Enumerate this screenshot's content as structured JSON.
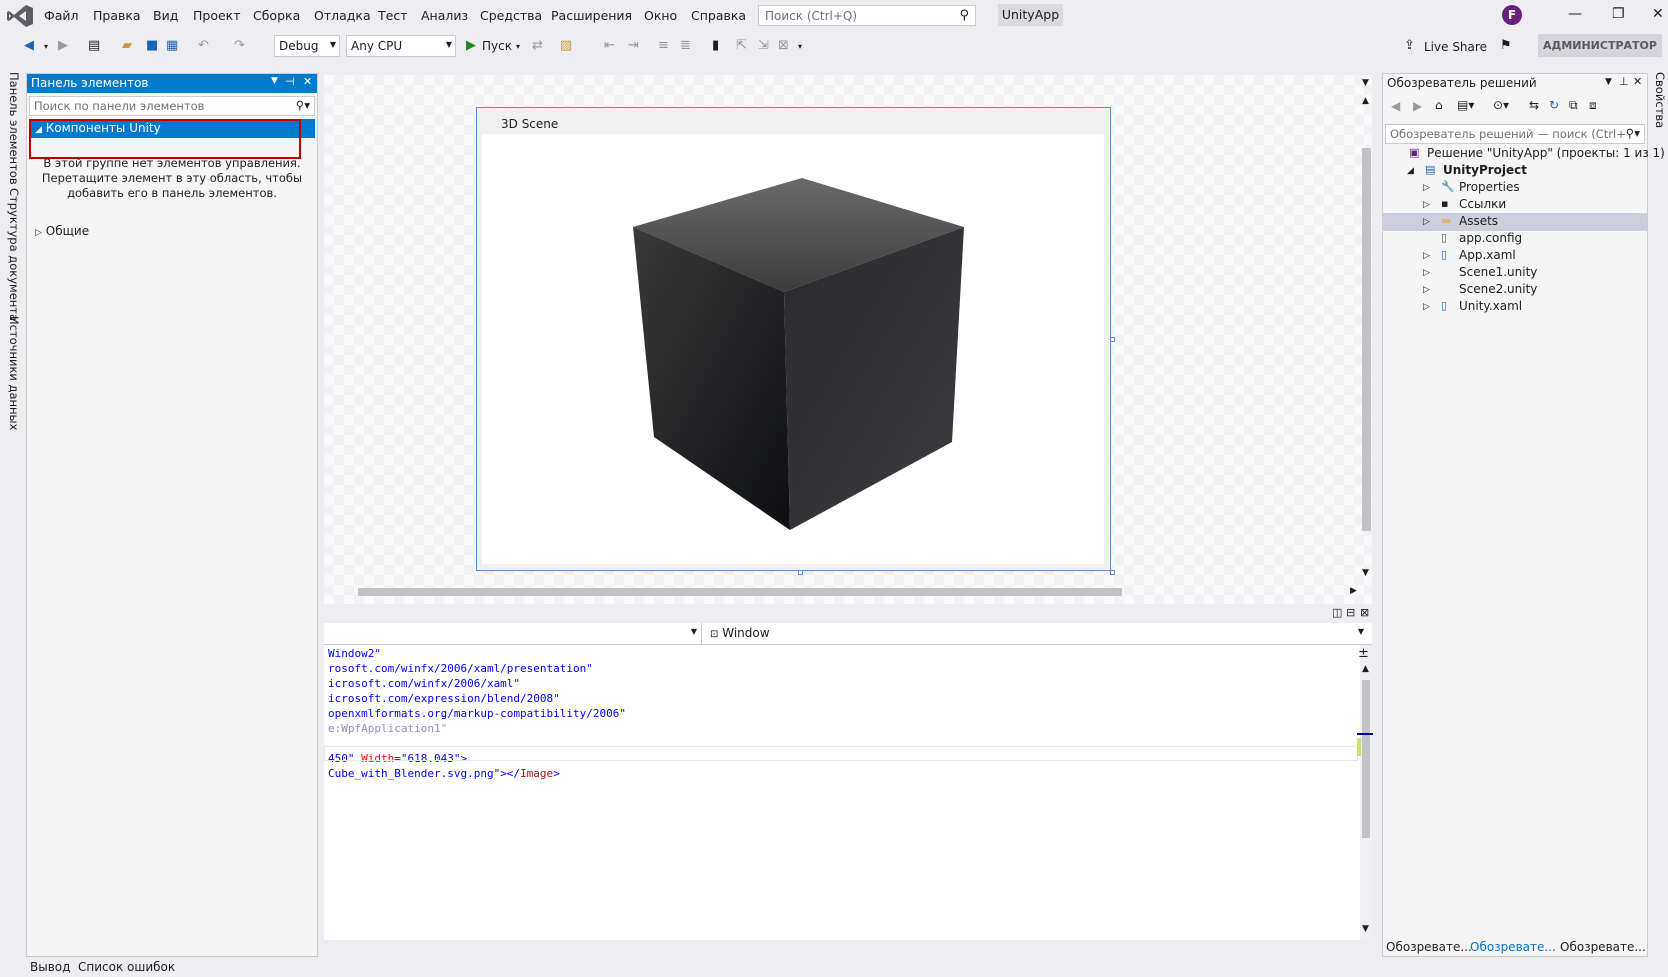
{
  "menubar": {
    "items": [
      "Файл",
      "Правка",
      "Вид",
      "Проект",
      "Сборка",
      "Отладка",
      "Тест",
      "Анализ",
      "Средства",
      "Расширения",
      "Окно",
      "Справка"
    ],
    "search_placeholder": "Поиск (Ctrl+Q)",
    "app_title": "UnityApp",
    "avatar_letter": "F"
  },
  "toolbar": {
    "config": "Debug",
    "platform": "Any CPU",
    "start": "Пуск",
    "live_share": "Live Share",
    "admin": "АДМИНИСТРАТОР"
  },
  "left_tabs": [
    "Панель элементов",
    "Структура документа",
    "Источники данных"
  ],
  "right_tabs": [
    "Свойства"
  ],
  "toolbox": {
    "title": "Панель элементов",
    "search_placeholder": "Поиск по панели элементов",
    "group_selected": "Компоненты Unity",
    "empty_line1": "В этой группе нет элементов управления.",
    "empty_line2": "Перетащите элемент в эту область, чтобы",
    "empty_line3": "добавить его в панель элементов.",
    "group_general": "Общие"
  },
  "designer": {
    "scene_title": "3D Scene",
    "element_combo": "Window"
  },
  "code_lines": [
    [
      {
        "t": "Window2\"",
        "c": "s"
      }
    ],
    [
      {
        "t": "rosoft.com/winfx/2006/xaml/presentation\"",
        "c": "s"
      }
    ],
    [
      {
        "t": "icrosoft.com/winfx/2006/xaml\"",
        "c": "s"
      }
    ],
    [
      {
        "t": "icrosoft.com/expression/blend/2008\"",
        "c": "s"
      }
    ],
    [
      {
        "t": "openxmlformats.org/markup-compatibility/2006\"",
        "c": "s"
      }
    ],
    [
      {
        "t": "e:WpfApplication1\"",
        "c": "g"
      }
    ],
    [
      {
        "t": "",
        "c": "k"
      }
    ],
    [
      {
        "t": "450\" ",
        "c": "s"
      },
      {
        "t": "Width",
        "c": "a"
      },
      {
        "t": "=",
        "c": "k"
      },
      {
        "t": "\"618.043\"",
        "c": "s"
      },
      {
        "t": ">",
        "c": "s"
      }
    ],
    [
      {
        "t": "Cube_with_Blender.svg.png\"",
        "c": "s"
      },
      {
        "t": "></",
        "c": "s"
      },
      {
        "t": "Image",
        "c": "t"
      },
      {
        "t": ">",
        "c": "s"
      }
    ]
  ],
  "solution_explorer": {
    "title": "Обозреватель решений",
    "search_placeholder": "Обозреватель решений — поиск (Ctrl+ж)",
    "items": [
      {
        "label": "Решение \"UnityApp\" (проекты: 1 из 1)",
        "indent": 0,
        "twisty": "",
        "icon": "solution-icon",
        "bold": false,
        "selected": false
      },
      {
        "label": "UnityProject",
        "indent": 1,
        "twisty": "◢",
        "icon": "csharp-project-icon",
        "bold": true,
        "selected": false
      },
      {
        "label": "Properties",
        "indent": 2,
        "twisty": "▷",
        "icon": "wrench-icon",
        "bold": false,
        "selected": false
      },
      {
        "label": "Ссылки",
        "indent": 2,
        "twisty": "▷",
        "icon": "references-icon",
        "bold": false,
        "selected": false
      },
      {
        "label": "Assets",
        "indent": 2,
        "twisty": "▷",
        "icon": "folder-icon",
        "bold": false,
        "selected": true
      },
      {
        "label": "app.config",
        "indent": 2,
        "twisty": "",
        "icon": "config-file-icon",
        "bold": false,
        "selected": false
      },
      {
        "label": "App.xaml",
        "indent": 2,
        "twisty": "▷",
        "icon": "xaml-file-icon",
        "bold": false,
        "selected": false
      },
      {
        "label": "Scene1.unity",
        "indent": 2,
        "twisty": "▷",
        "icon": "file-icon",
        "bold": false,
        "selected": false
      },
      {
        "label": "Scene2.unity",
        "indent": 2,
        "twisty": "▷",
        "icon": "file-icon",
        "bold": false,
        "selected": false
      },
      {
        "label": "Unity.xaml",
        "indent": 2,
        "twisty": "▷",
        "icon": "xaml-file-icon",
        "bold": false,
        "selected": false
      }
    ],
    "bottom_tabs": [
      "Обозревате...",
      "Обозревате...",
      "Обозревате..."
    ]
  },
  "statusbar": {
    "tabs": [
      "Вывод",
      "Список ошибок"
    ]
  }
}
